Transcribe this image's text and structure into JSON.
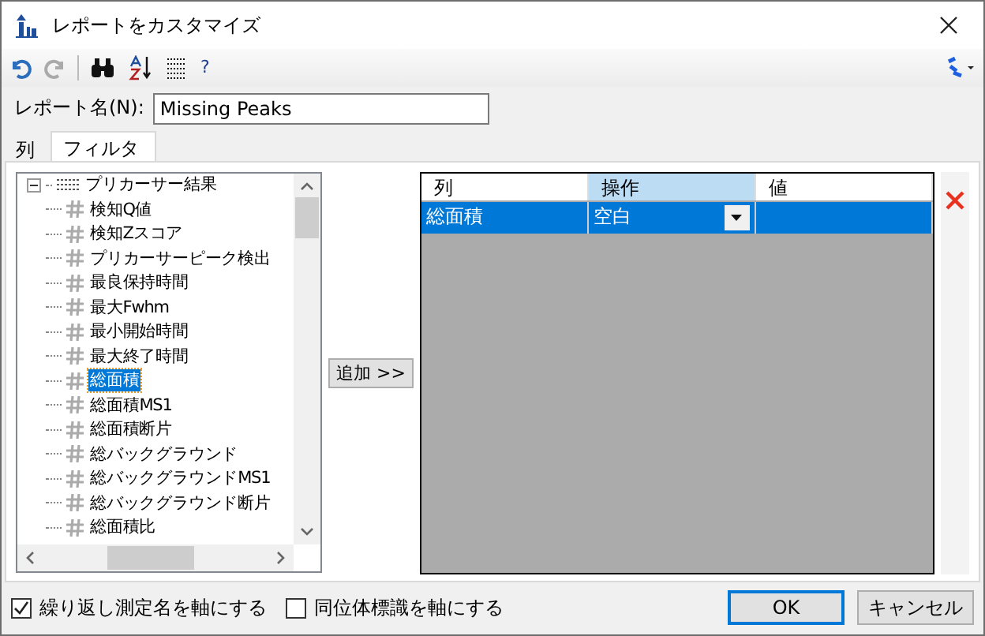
{
  "window": {
    "title": "レポートをカスタマイズ"
  },
  "toolbar": {
    "help": "?"
  },
  "report_name": {
    "label": "レポート名(N):",
    "value": "Missing Peaks"
  },
  "tabs": [
    {
      "label": "列",
      "selected": false
    },
    {
      "label": "フィルタ",
      "selected": true
    }
  ],
  "tree": {
    "label": "プリカーサー結果",
    "expanded": true,
    "children": [
      {
        "label": "検知Q値",
        "selected": false
      },
      {
        "label": "検知Zスコア",
        "selected": false
      },
      {
        "label": "プリカーサーピーク検出",
        "selected": false
      },
      {
        "label": "最良保持時間",
        "selected": false
      },
      {
        "label": "最大Fwhm",
        "selected": false
      },
      {
        "label": "最小開始時間",
        "selected": false
      },
      {
        "label": "最大終了時間",
        "selected": false
      },
      {
        "label": "総面積",
        "selected": true
      },
      {
        "label": "総面積MS1",
        "selected": false
      },
      {
        "label": "総面積断片",
        "selected": false
      },
      {
        "label": "総バックグラウンド",
        "selected": false
      },
      {
        "label": "総バックグラウンドMS1",
        "selected": false
      },
      {
        "label": "総バックグラウンド断片",
        "selected": false
      },
      {
        "label": "総面積比",
        "selected": false
      }
    ]
  },
  "add_button": "追加 >>",
  "grid": {
    "columns": [
      {
        "label": "列",
        "selected": false
      },
      {
        "label": "操作",
        "selected": true
      },
      {
        "label": "値",
        "selected": false
      }
    ],
    "rows": [
      {
        "cells": [
          "総面積",
          "空白",
          ""
        ],
        "selected": true
      }
    ]
  },
  "options": [
    {
      "label": "繰り返し測定名を軸にする",
      "checked": true
    },
    {
      "label": "同位体標識を軸にする",
      "checked": false
    }
  ],
  "buttons": [
    {
      "label": "OK",
      "default": true
    },
    {
      "label": "キャンセル",
      "default": false
    }
  ]
}
